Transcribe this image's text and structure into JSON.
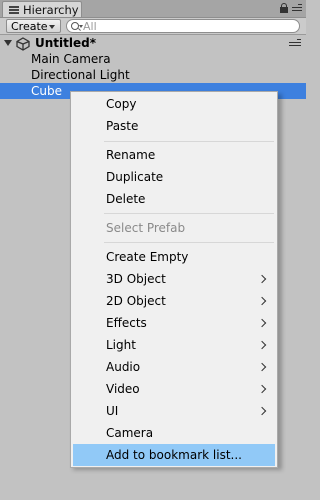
{
  "window": {
    "tab_title": "Hierarchy"
  },
  "toolbar": {
    "create_label": "Create",
    "search_placeholder": "All"
  },
  "scene": {
    "name": "Untitled*"
  },
  "hierarchy": {
    "items": [
      "Main Camera",
      "Directional Light",
      "Cube"
    ],
    "selected": "Cube"
  },
  "colors": {
    "selection": "#3d80df",
    "menu_highlight": "#91c9f7",
    "panel_bg": "#c2c2c2"
  },
  "context_menu": {
    "items": [
      {
        "label": "Copy"
      },
      {
        "label": "Paste"
      },
      {
        "label": "Rename"
      },
      {
        "label": "Duplicate"
      },
      {
        "label": "Delete"
      },
      {
        "label": "Select Prefab",
        "disabled": true
      },
      {
        "label": "Create Empty"
      },
      {
        "label": "3D Object",
        "submenu": true
      },
      {
        "label": "2D Object",
        "submenu": true
      },
      {
        "label": "Effects",
        "submenu": true
      },
      {
        "label": "Light",
        "submenu": true
      },
      {
        "label": "Audio",
        "submenu": true
      },
      {
        "label": "Video",
        "submenu": true
      },
      {
        "label": "UI",
        "submenu": true
      },
      {
        "label": "Camera"
      },
      {
        "label": "Add to bookmark list...",
        "highlighted": true
      }
    ]
  }
}
